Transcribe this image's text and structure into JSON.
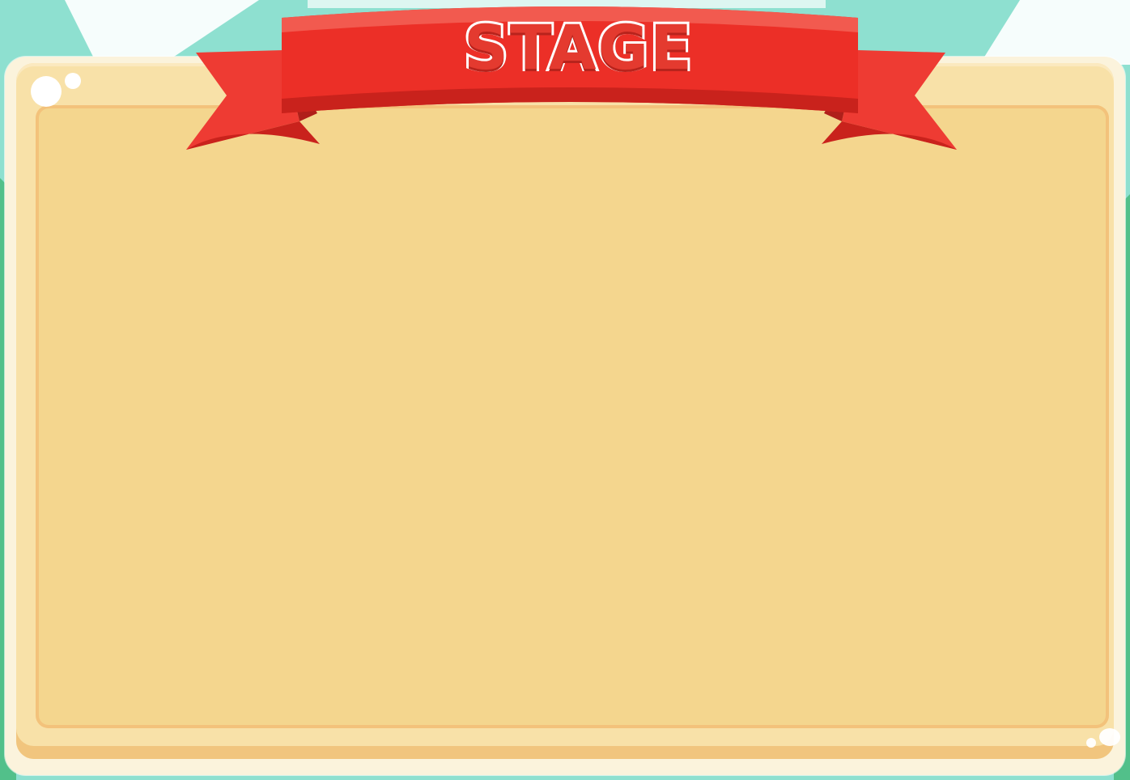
{
  "stage_panel": {
    "title": "STAGE"
  },
  "colors": {
    "sky": "#8ee0d0",
    "grass": "#52c08a",
    "panel_outer": "#fbf3dc",
    "panel_frame": "#f8e1a8",
    "panel_inner": "#f4d68e",
    "ribbon": "#ec2f27",
    "ribbon_dark": "#c9221c",
    "title_text": "#e43a2f"
  },
  "icons": [
    "ribbon-banner",
    "bubble-decoration"
  ]
}
